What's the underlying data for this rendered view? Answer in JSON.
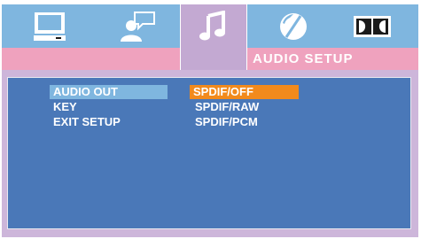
{
  "header": {
    "title": "AUDIO SETUP",
    "tabs": [
      {
        "name": "general",
        "icon": "tv-monitor-icon"
      },
      {
        "name": "language",
        "icon": "person-speech-icon"
      },
      {
        "name": "audio",
        "icon": "music-note-icon",
        "active": true
      },
      {
        "name": "video",
        "icon": "color-disc-icon"
      },
      {
        "name": "dolby",
        "icon": "dolby-logo-icon"
      }
    ]
  },
  "menu": {
    "items": [
      "AUDIO OUT",
      "KEY",
      "EXIT SETUP"
    ],
    "selected_index": 0
  },
  "options": {
    "items": [
      "SPDIF/OFF",
      "SPDIF/RAW",
      "SPDIF/PCM"
    ],
    "selected_index": 0
  },
  "colors": {
    "tab_strip": "#7fb6df",
    "title_bar": "#efa2be",
    "active_tab": "#c3a9d2",
    "panel": "#4a78b8",
    "menu_highlight": "#7fb6df",
    "option_highlight": "#f28a1c"
  }
}
